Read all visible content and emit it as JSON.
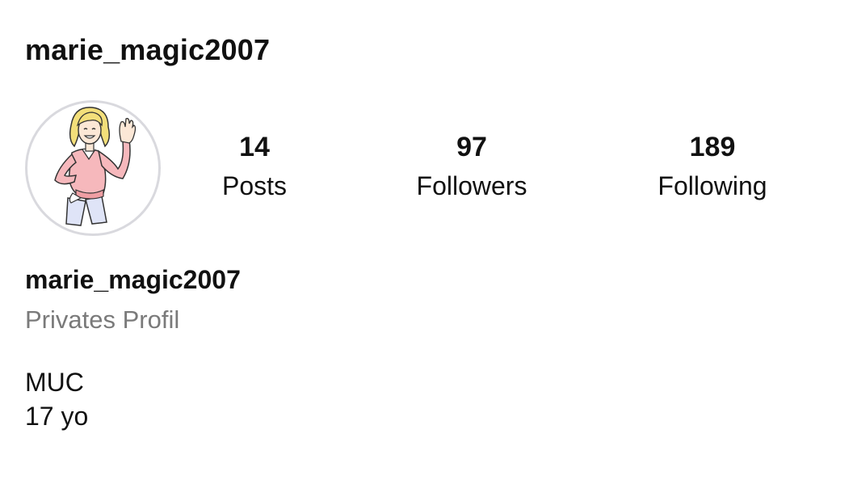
{
  "header": {
    "username": "marie_magic2007"
  },
  "avatar": {
    "icon": "cartoon-girl-waving-avatar"
  },
  "stats": {
    "posts": {
      "count": "14",
      "label": "Posts"
    },
    "followers": {
      "count": "97",
      "label": "Followers"
    },
    "following": {
      "count": "189",
      "label": "Following"
    }
  },
  "profile": {
    "name": "marie_magic2007",
    "status": "Privates Profil",
    "bio": [
      "MUC",
      "17 yo"
    ]
  },
  "colors": {
    "text": "#111111",
    "muted": "#7a7a7a",
    "avatar_border": "#d9d9de"
  }
}
